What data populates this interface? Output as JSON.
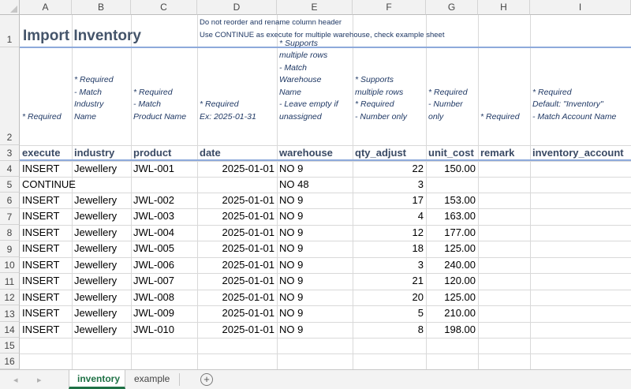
{
  "columns": [
    "A",
    "B",
    "C",
    "D",
    "E",
    "F",
    "G",
    "H",
    "I"
  ],
  "row_numbers": [
    "1",
    "2",
    "3",
    "4",
    "5",
    "6",
    "7",
    "8",
    "9",
    "10",
    "11",
    "12",
    "13",
    "14",
    "15",
    "16"
  ],
  "title": "Import Inventory",
  "notes": [
    "Do not reorder and rename column header",
    "Use CONTINUE as execute for multiple warehouse, check example sheet"
  ],
  "help": {
    "execute": "* Required",
    "industry": "* Required\n- Match\nIndustry\nName",
    "product": "* Required\n- Match\nProduct Name",
    "date": "* Required\nEx: 2025-01-31",
    "warehouse": "* Supports\nmultiple rows\n- Match\nWarehouse\nName\n- Leave empty if\nunassigned",
    "qty_adjust": "* Supports\nmultiple rows\n* Required\n- Number only",
    "unit_cost": "* Required\n- Number\nonly",
    "remark": "* Required",
    "inventory_account": "* Required\nDefault: \"Inventory\"\n- Match Account Name"
  },
  "headers": [
    "execute",
    "industry",
    "product",
    "date",
    "warehouse",
    "qty_adjust",
    "unit_cost",
    "remark",
    "inventory_account"
  ],
  "rows": [
    [
      "INSERT",
      "Jewellery",
      "JWL-001",
      "2025-01-01",
      "NO 9",
      "22",
      "150.00"
    ],
    [
      "CONTINUE",
      "",
      "",
      "",
      "NO 48",
      "3",
      ""
    ],
    [
      "INSERT",
      "Jewellery",
      "JWL-002",
      "2025-01-01",
      "NO 9",
      "17",
      "153.00"
    ],
    [
      "INSERT",
      "Jewellery",
      "JWL-003",
      "2025-01-01",
      "NO 9",
      "4",
      "163.00"
    ],
    [
      "INSERT",
      "Jewellery",
      "JWL-004",
      "2025-01-01",
      "NO 9",
      "12",
      "177.00"
    ],
    [
      "INSERT",
      "Jewellery",
      "JWL-005",
      "2025-01-01",
      "NO 9",
      "18",
      "125.00"
    ],
    [
      "INSERT",
      "Jewellery",
      "JWL-006",
      "2025-01-01",
      "NO 9",
      "3",
      "240.00"
    ],
    [
      "INSERT",
      "Jewellery",
      "JWL-007",
      "2025-01-01",
      "NO 9",
      "21",
      "120.00"
    ],
    [
      "INSERT",
      "Jewellery",
      "JWL-008",
      "2025-01-01",
      "NO 9",
      "20",
      "125.00"
    ],
    [
      "INSERT",
      "Jewellery",
      "JWL-009",
      "2025-01-01",
      "NO 9",
      "5",
      "210.00"
    ],
    [
      "INSERT",
      "Jewellery",
      "JWL-010",
      "2025-01-01",
      "NO 9",
      "8",
      "198.00"
    ]
  ],
  "tabs": [
    "inventory",
    "example"
  ],
  "active_tab": "inventory",
  "add_sheet_label": "+",
  "nav_prev": "◂",
  "nav_next": "▸"
}
